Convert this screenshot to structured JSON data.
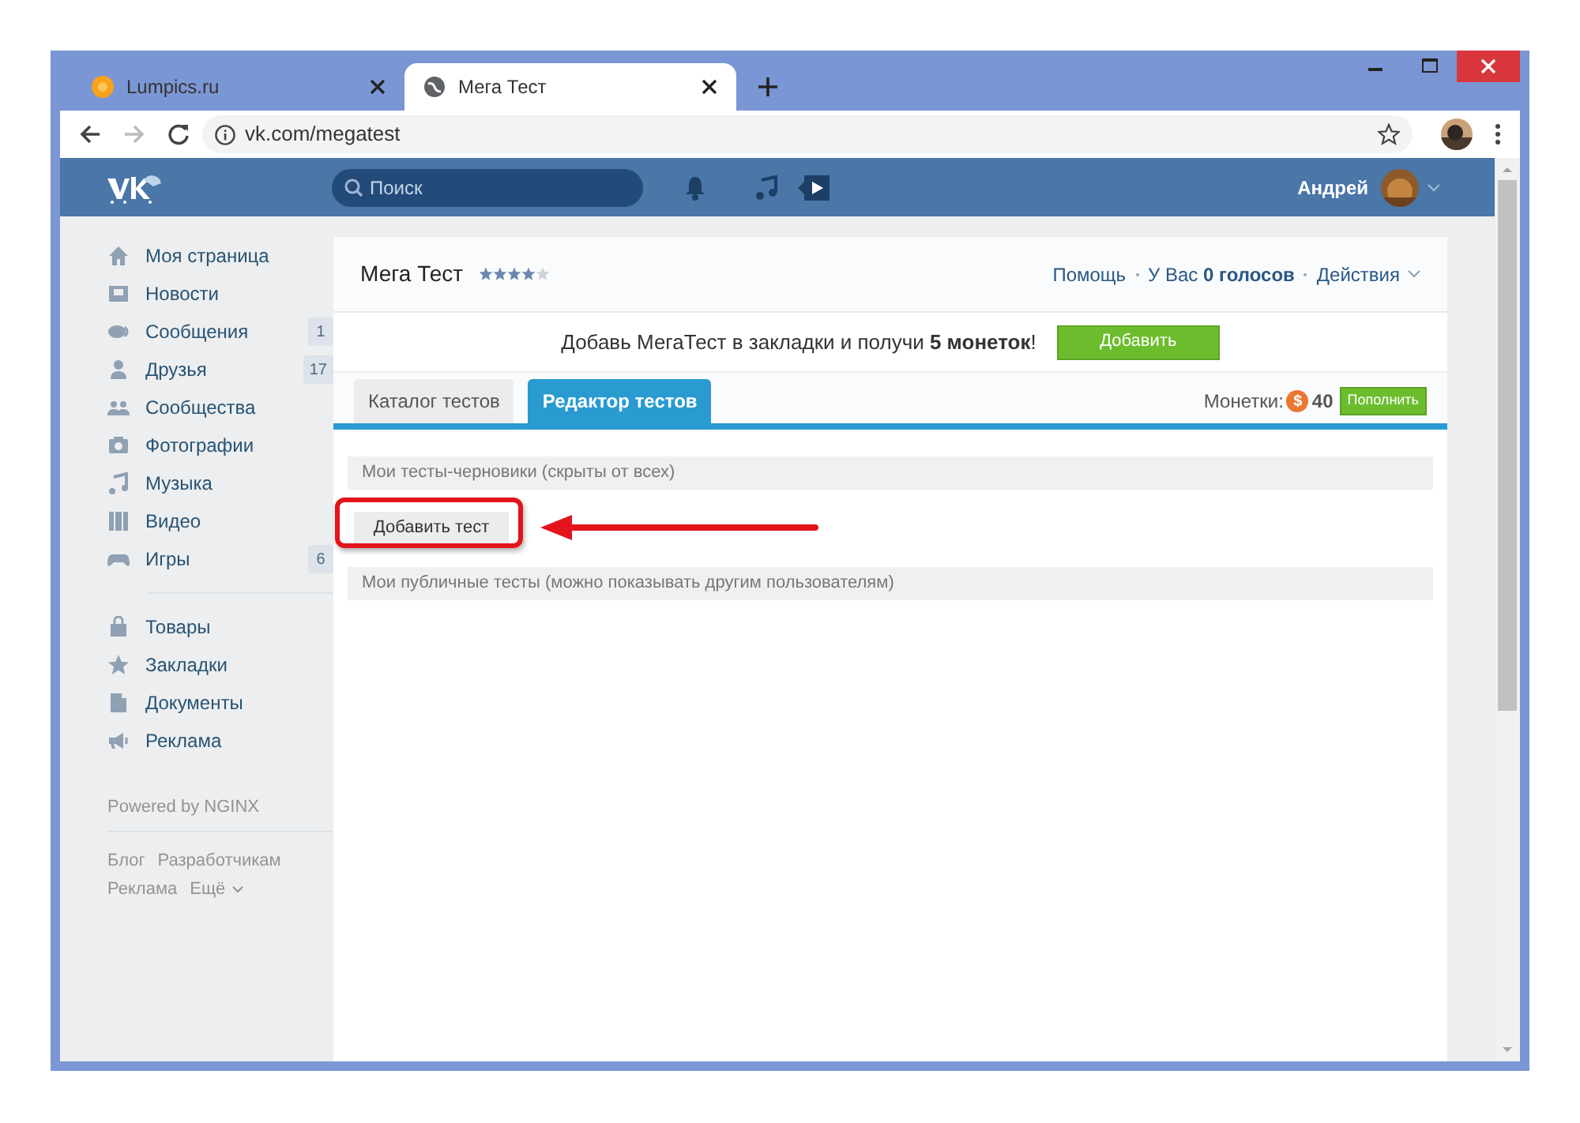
{
  "browser": {
    "tabs": [
      {
        "title": "Lumpics.ru",
        "selected": false
      },
      {
        "title": "Мега Тест",
        "selected": true
      }
    ],
    "url": "vk.com/megatest"
  },
  "header": {
    "search_placeholder": "Поиск",
    "user_name": "Андрей"
  },
  "sidebar": {
    "main_items": [
      {
        "label": "Моя страница"
      },
      {
        "label": "Новости"
      },
      {
        "label": "Сообщения",
        "badge": "1"
      },
      {
        "label": "Друзья",
        "badge": "17"
      },
      {
        "label": "Сообщества"
      },
      {
        "label": "Фотографии"
      },
      {
        "label": "Музыка"
      },
      {
        "label": "Видео"
      },
      {
        "label": "Игры",
        "badge": "6"
      }
    ],
    "extra_items": [
      {
        "label": "Товары"
      },
      {
        "label": "Закладки"
      },
      {
        "label": "Документы"
      },
      {
        "label": "Реклама"
      }
    ],
    "powered_by": "Powered by NGINX",
    "footer_links": [
      "Блог",
      "Разработчикам",
      "Реклама",
      "Ещё"
    ]
  },
  "app": {
    "title": "Мега Тест",
    "stars": 4,
    "header_links": [
      "Помощь",
      "У Вас **0 голосов**",
      "Действия"
    ],
    "promo": {
      "text": "Добавь МегаТест в закладки и получи **5 монеток**!",
      "button": "Добавить"
    },
    "tabs": [
      {
        "label": "Каталог тестов",
        "selected": false
      },
      {
        "label": "Редактор тестов",
        "selected": true
      }
    ],
    "coins": {
      "label": "Монетки:",
      "symbol": "$",
      "amount": "40",
      "button": "Пополнить"
    },
    "sections": [
      {
        "title": "Мои тесты-черновики (скрыты от всех)",
        "button": "Добавить тест"
      },
      {
        "title": "Мои публичные тесты (можно показывать другим пользователям)"
      }
    ]
  }
}
